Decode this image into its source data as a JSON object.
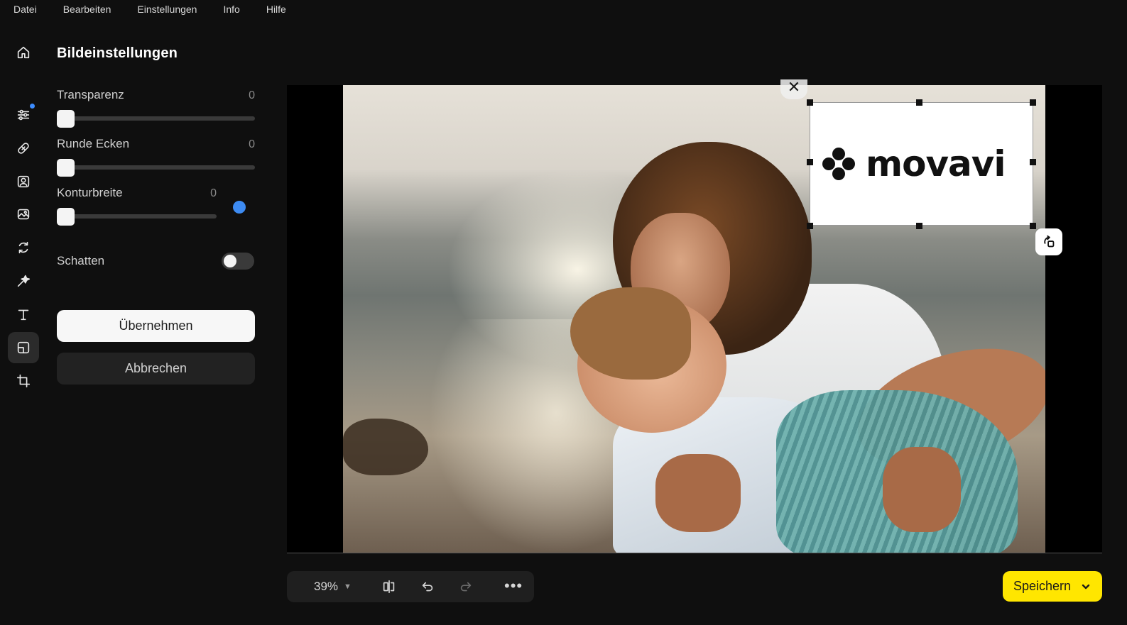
{
  "menu": [
    "Datei",
    "Bearbeiten",
    "Einstellungen",
    "Info",
    "Hilfe"
  ],
  "rail": {
    "items": [
      {
        "name": "home-icon",
        "active": false
      },
      {
        "name": "adjustments-icon",
        "active": false,
        "badge": true
      },
      {
        "name": "retouch-bandage-icon",
        "active": false
      },
      {
        "name": "portrait-icon",
        "active": false
      },
      {
        "name": "image-edit-icon",
        "active": false
      },
      {
        "name": "replace-icon",
        "active": false
      },
      {
        "name": "magic-wand-icon",
        "active": false
      },
      {
        "name": "text-icon",
        "active": false
      },
      {
        "name": "watermark-icon",
        "active": true
      },
      {
        "name": "crop-icon",
        "active": false
      }
    ]
  },
  "panel": {
    "title": "Bildeinstellungen",
    "transparency": {
      "label": "Transparenz",
      "value": "0",
      "level": 0
    },
    "corners": {
      "label": "Runde Ecken",
      "value": "0",
      "level": 0
    },
    "outline": {
      "label": "Konturbreite",
      "value": "0",
      "level": 0,
      "color": "#3d8bf2"
    },
    "shadow": {
      "label": "Schatten",
      "enabled": false
    },
    "apply_label": "Übernehmen",
    "cancel_label": "Abbrechen"
  },
  "canvas": {
    "watermark_text": "movavi",
    "close_symbol": "✕"
  },
  "toolbar": {
    "zoom": "39%",
    "more": "•••"
  },
  "save": {
    "label": "Speichern",
    "color": "#ffe600"
  }
}
